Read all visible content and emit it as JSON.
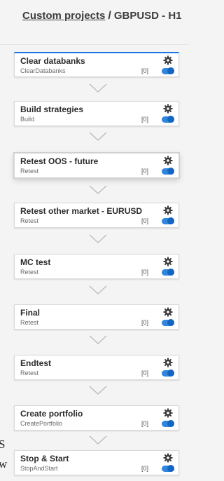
{
  "breadcrumb": {
    "link_label": "Custom projects",
    "separator": "/",
    "current": "GBPUSD - H1"
  },
  "tasks": [
    {
      "title": "Clear databanks",
      "subtitle": "ClearDatabanks",
      "count": "[0]",
      "enabled": true
    },
    {
      "title": "Build strategies",
      "subtitle": "Build",
      "count": "[0]",
      "enabled": true
    },
    {
      "title": "Retest OOS - future",
      "subtitle": "Retest",
      "count": "[0]",
      "enabled": true
    },
    {
      "title": "Retest other market - EURUSD",
      "subtitle": "Retest",
      "count": "[0]",
      "enabled": true
    },
    {
      "title": "MC test",
      "subtitle": "Retest",
      "count": "[0]",
      "enabled": true
    },
    {
      "title": "Final",
      "subtitle": "Retest",
      "count": "[0]",
      "enabled": true
    },
    {
      "title": "Endtest",
      "subtitle": "Retest",
      "count": "[0]",
      "enabled": true
    },
    {
      "title": "Create portfolio",
      "subtitle": "CreatePortfolio",
      "count": "[0]",
      "enabled": true
    },
    {
      "title": "Stop & Start",
      "subtitle": "StopAndStart",
      "count": "[0]",
      "enabled": true
    }
  ],
  "icons": {
    "settings": "gear-icon",
    "connector": "chevron-down-icon",
    "toggle": "toggle-switch"
  },
  "colors": {
    "toggle_on": "#2e86de",
    "active_border": "#1a73e8",
    "background": "#f4f4f4"
  },
  "left_edge_fragments": [
    "S",
    "w"
  ]
}
